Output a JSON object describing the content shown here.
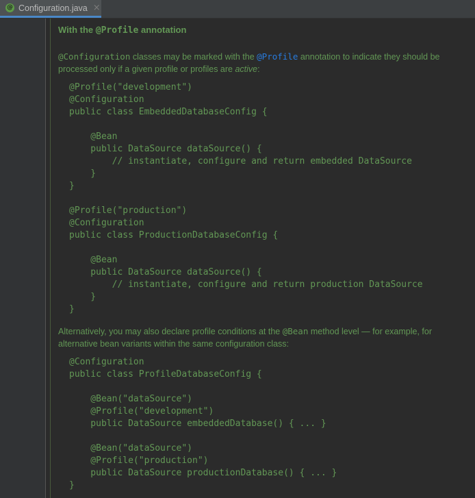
{
  "tab": {
    "icon": "spring-config-icon",
    "label": "Configuration.java",
    "close": "×"
  },
  "doc": {
    "heading_prefix": "With the ",
    "heading_code": "@Profile",
    "heading_suffix": " annotation",
    "para1": {
      "code1": "@Configuration",
      "text1": " classes may be marked with the ",
      "link": "@Profile",
      "text2": " annotation to indicate they should be processed only if a given profile or profiles are ",
      "emph": "active",
      "text3": ":"
    },
    "code_block_1": "@Profile(\"development\")\n@Configuration\npublic class EmbeddedDatabaseConfig {\n\n    @Bean\n    public DataSource dataSource() {\n        // instantiate, configure and return embedded DataSource\n    }\n}\n\n@Profile(\"production\")\n@Configuration\npublic class ProductionDatabaseConfig {\n\n    @Bean\n    public DataSource dataSource() {\n        // instantiate, configure and return production DataSource\n    }\n}",
    "para2": {
      "text1": "Alternatively, you may also declare profile conditions at the ",
      "code1": "@Bean",
      "text2": " method level — for example, for alternative bean variants within the same configuration class:"
    },
    "code_block_3": "@Configuration\npublic class ProfileDatabaseConfig {\n\n    @Bean(\"dataSource\")\n    @Profile(\"development\")\n    public DataSource embeddedDatabase() { ... }\n\n    @Bean(\"dataSource\")\n    @Profile(\"production\")\n    public DataSource productionDatabase() { ... }\n}"
  }
}
